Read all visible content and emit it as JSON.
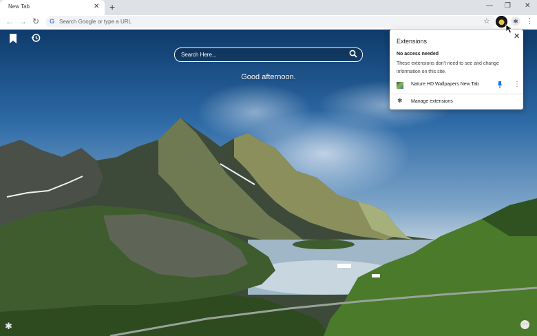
{
  "tab": {
    "title": "New Tab",
    "close_glyph": "✕",
    "new_tab_glyph": "+"
  },
  "window": {
    "minimize": "—",
    "restore": "❐",
    "close": "✕"
  },
  "toolbar": {
    "back": "←",
    "forward": "→",
    "reload": "↻",
    "omnibox_placeholder": "Search Google or type a URL",
    "star": "☆",
    "menu": "⋮",
    "extensions_glyph": "✱"
  },
  "newtab": {
    "bookmark_icon": "bookmark-icon",
    "history_icon": "history-icon",
    "search_placeholder": "Search Here...",
    "search_glyph": "⌕",
    "greeting": "Good afternoon.",
    "settings_glyph": "✱",
    "apps_glyph": "⋯"
  },
  "extensions_popup": {
    "title": "Extensions",
    "close_glyph": "✕",
    "section_title": "No access needed",
    "section_description": "These extensions don't need to see and change information on this site.",
    "items": [
      {
        "name": "Nature HD Wallpapers New Tab",
        "pinned": true
      }
    ],
    "pin_glyph": "✎",
    "more_glyph": "⋮",
    "manage_label": "Manage extensions",
    "manage_glyph": "✱"
  },
  "colors": {
    "accent": "#1a73e8",
    "tabstrip": "#dee1e6",
    "sky": "#2d6aa6"
  }
}
